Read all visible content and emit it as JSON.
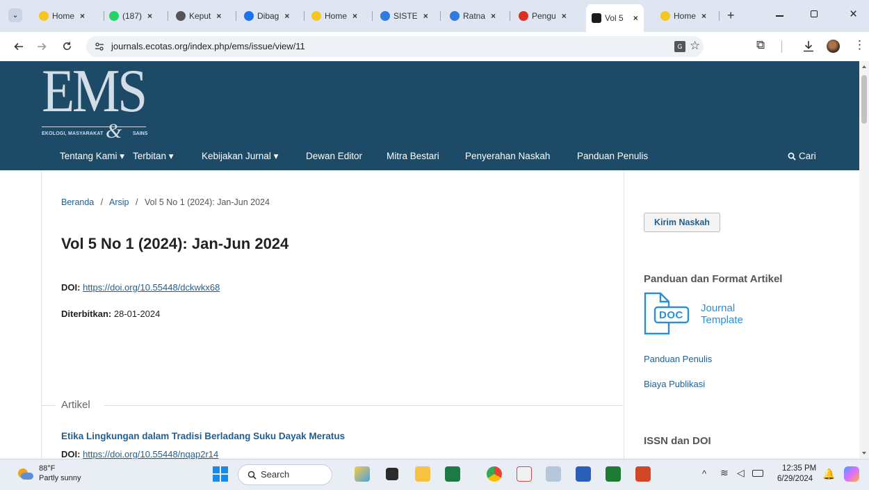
{
  "browser": {
    "tabs": [
      {
        "label": "Home",
        "color": "#f3c623"
      },
      {
        "label": "(187)",
        "color": "#25d366"
      },
      {
        "label": "Keput",
        "color": "#555555"
      },
      {
        "label": "Dibag",
        "color": "#1a73e8"
      },
      {
        "label": "Home",
        "color": "#f3c623"
      },
      {
        "label": "SISTE",
        "color": "#2f7be0"
      },
      {
        "label": "Ratna",
        "color": "#2f7be0"
      },
      {
        "label": "Pengu",
        "color": "#d93025"
      },
      {
        "label": "Vol 5",
        "color": "#1b1b1b"
      },
      {
        "label": "Home",
        "color": "#f3c623"
      }
    ],
    "close_glyph": "×",
    "new_tab": "+",
    "url": "journals.ecotas.org/index.php/ems/issue/view/11"
  },
  "site": {
    "logo_big": "EMS",
    "logo_small_left": "EKOLOGI, MASYARAKAT",
    "logo_amp": "&",
    "logo_small_right": "SAINS",
    "nav": [
      "Tentang Kami ▾",
      "Terbitan ▾",
      "Kebijakan Jurnal ▾",
      "Dewan Editor",
      "Mitra Bestari",
      "Penyerahan Naskah",
      "Panduan Penulis"
    ],
    "search_label": "Cari"
  },
  "content": {
    "breadcrumb": [
      "Beranda",
      "Arsip",
      "Vol 5 No 1 (2024): Jan-Jun 2024"
    ],
    "breadcrumb_sep": "/",
    "title": "Vol 5 No 1 (2024): Jan-Jun 2024",
    "doi_label": "DOI:",
    "doi_value": "https://doi.org/10.55448/dckwkx68",
    "published_label": "Diterbitkan:",
    "published_value": "28-01-2024",
    "section_label": "Artikel",
    "article_title": "Etika Lingkungan dalam Tradisi Berladang Suku Dayak Meratus",
    "article_doi_label": "DOI:",
    "article_doi_value": "https://doi.org/10.55448/nqap2r14"
  },
  "sidebar": {
    "submit_button": "Kirim Naskah",
    "guide_heading": "Panduan dan Format Artikel",
    "doc_icon_text": "DOC",
    "template_line1": "Journal",
    "template_line2": "Template",
    "links": [
      "Panduan Penulis",
      "Biaya Publikasi"
    ],
    "issn_heading": "ISSN dan DOI"
  },
  "taskbar": {
    "temp": "88°F",
    "weather": "Partly sunny",
    "search": "Search",
    "time": "12:35 PM",
    "date": "6/29/2024"
  }
}
